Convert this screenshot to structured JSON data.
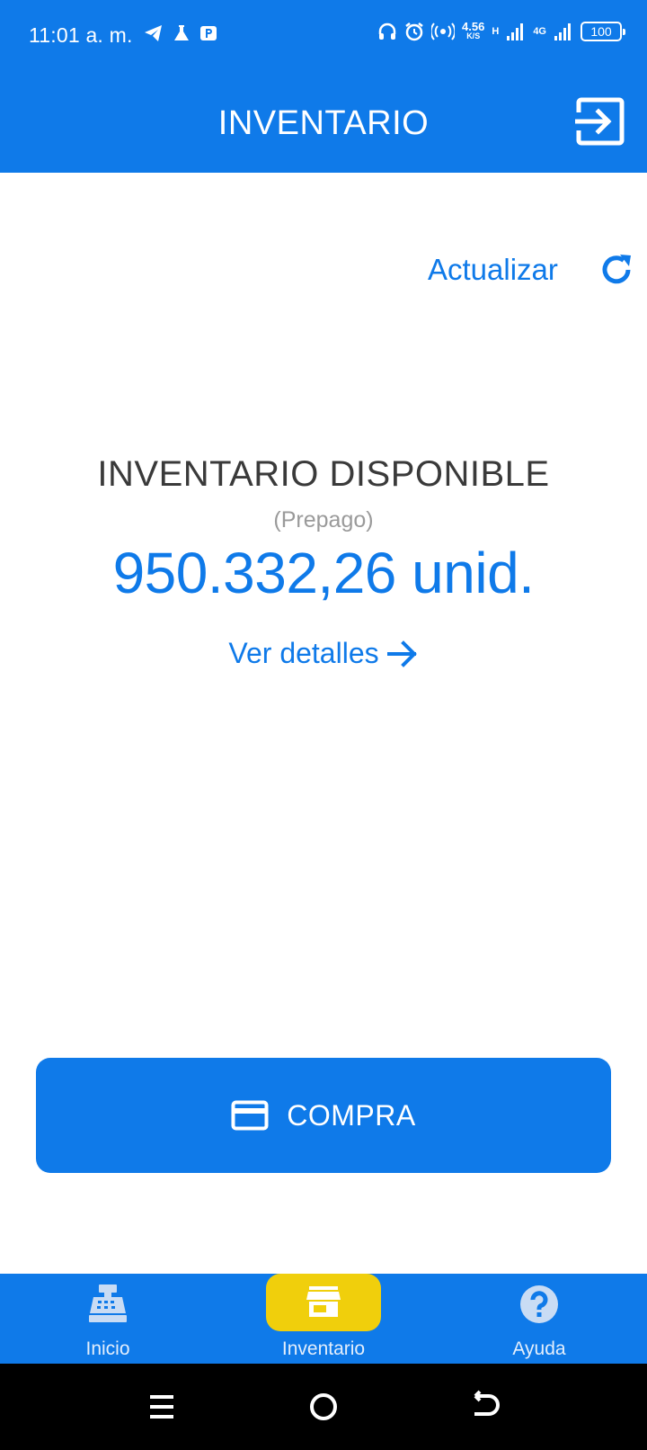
{
  "colors": {
    "primary": "#0f7ae9",
    "accent": "#f0cf0c",
    "text_dark": "#3a3a3a",
    "text_muted": "#9a9a9a"
  },
  "status_bar": {
    "time": "11:01 a. m.",
    "left_icons": [
      "telegram-icon",
      "flask-icon",
      "parking-app-icon"
    ],
    "right_icons": [
      "headphones-icon",
      "alarm-icon",
      "hotspot-icon",
      "signal-h-icon",
      "signal-4g-icon",
      "battery-icon"
    ],
    "net_speed_value": "4.56",
    "net_speed_unit": "K/S",
    "network_type_1": "H",
    "network_type_2": "4G",
    "battery_level": "100"
  },
  "header": {
    "title": "INVENTARIO",
    "exit_icon": "exit-icon"
  },
  "refresh": {
    "label": "Actualizar",
    "icon": "refresh-icon"
  },
  "inventory": {
    "title": "INVENTARIO DISPONIBLE",
    "subtitle": "(Prepago)",
    "amount": "950.332,26 unid.",
    "details_label": "Ver detalles",
    "details_icon": "arrow-right-icon"
  },
  "compra_button": {
    "label": "COMPRA",
    "icon": "credit-card-icon"
  },
  "bottom_nav": {
    "items": [
      {
        "label": "Inicio",
        "icon": "cash-register-icon",
        "active": false
      },
      {
        "label": "Inventario",
        "icon": "store-icon",
        "active": true
      },
      {
        "label": "Ayuda",
        "icon": "help-icon",
        "active": false
      }
    ]
  },
  "system_nav": {
    "icons": [
      "menu-icon",
      "home-icon",
      "back-icon"
    ]
  }
}
